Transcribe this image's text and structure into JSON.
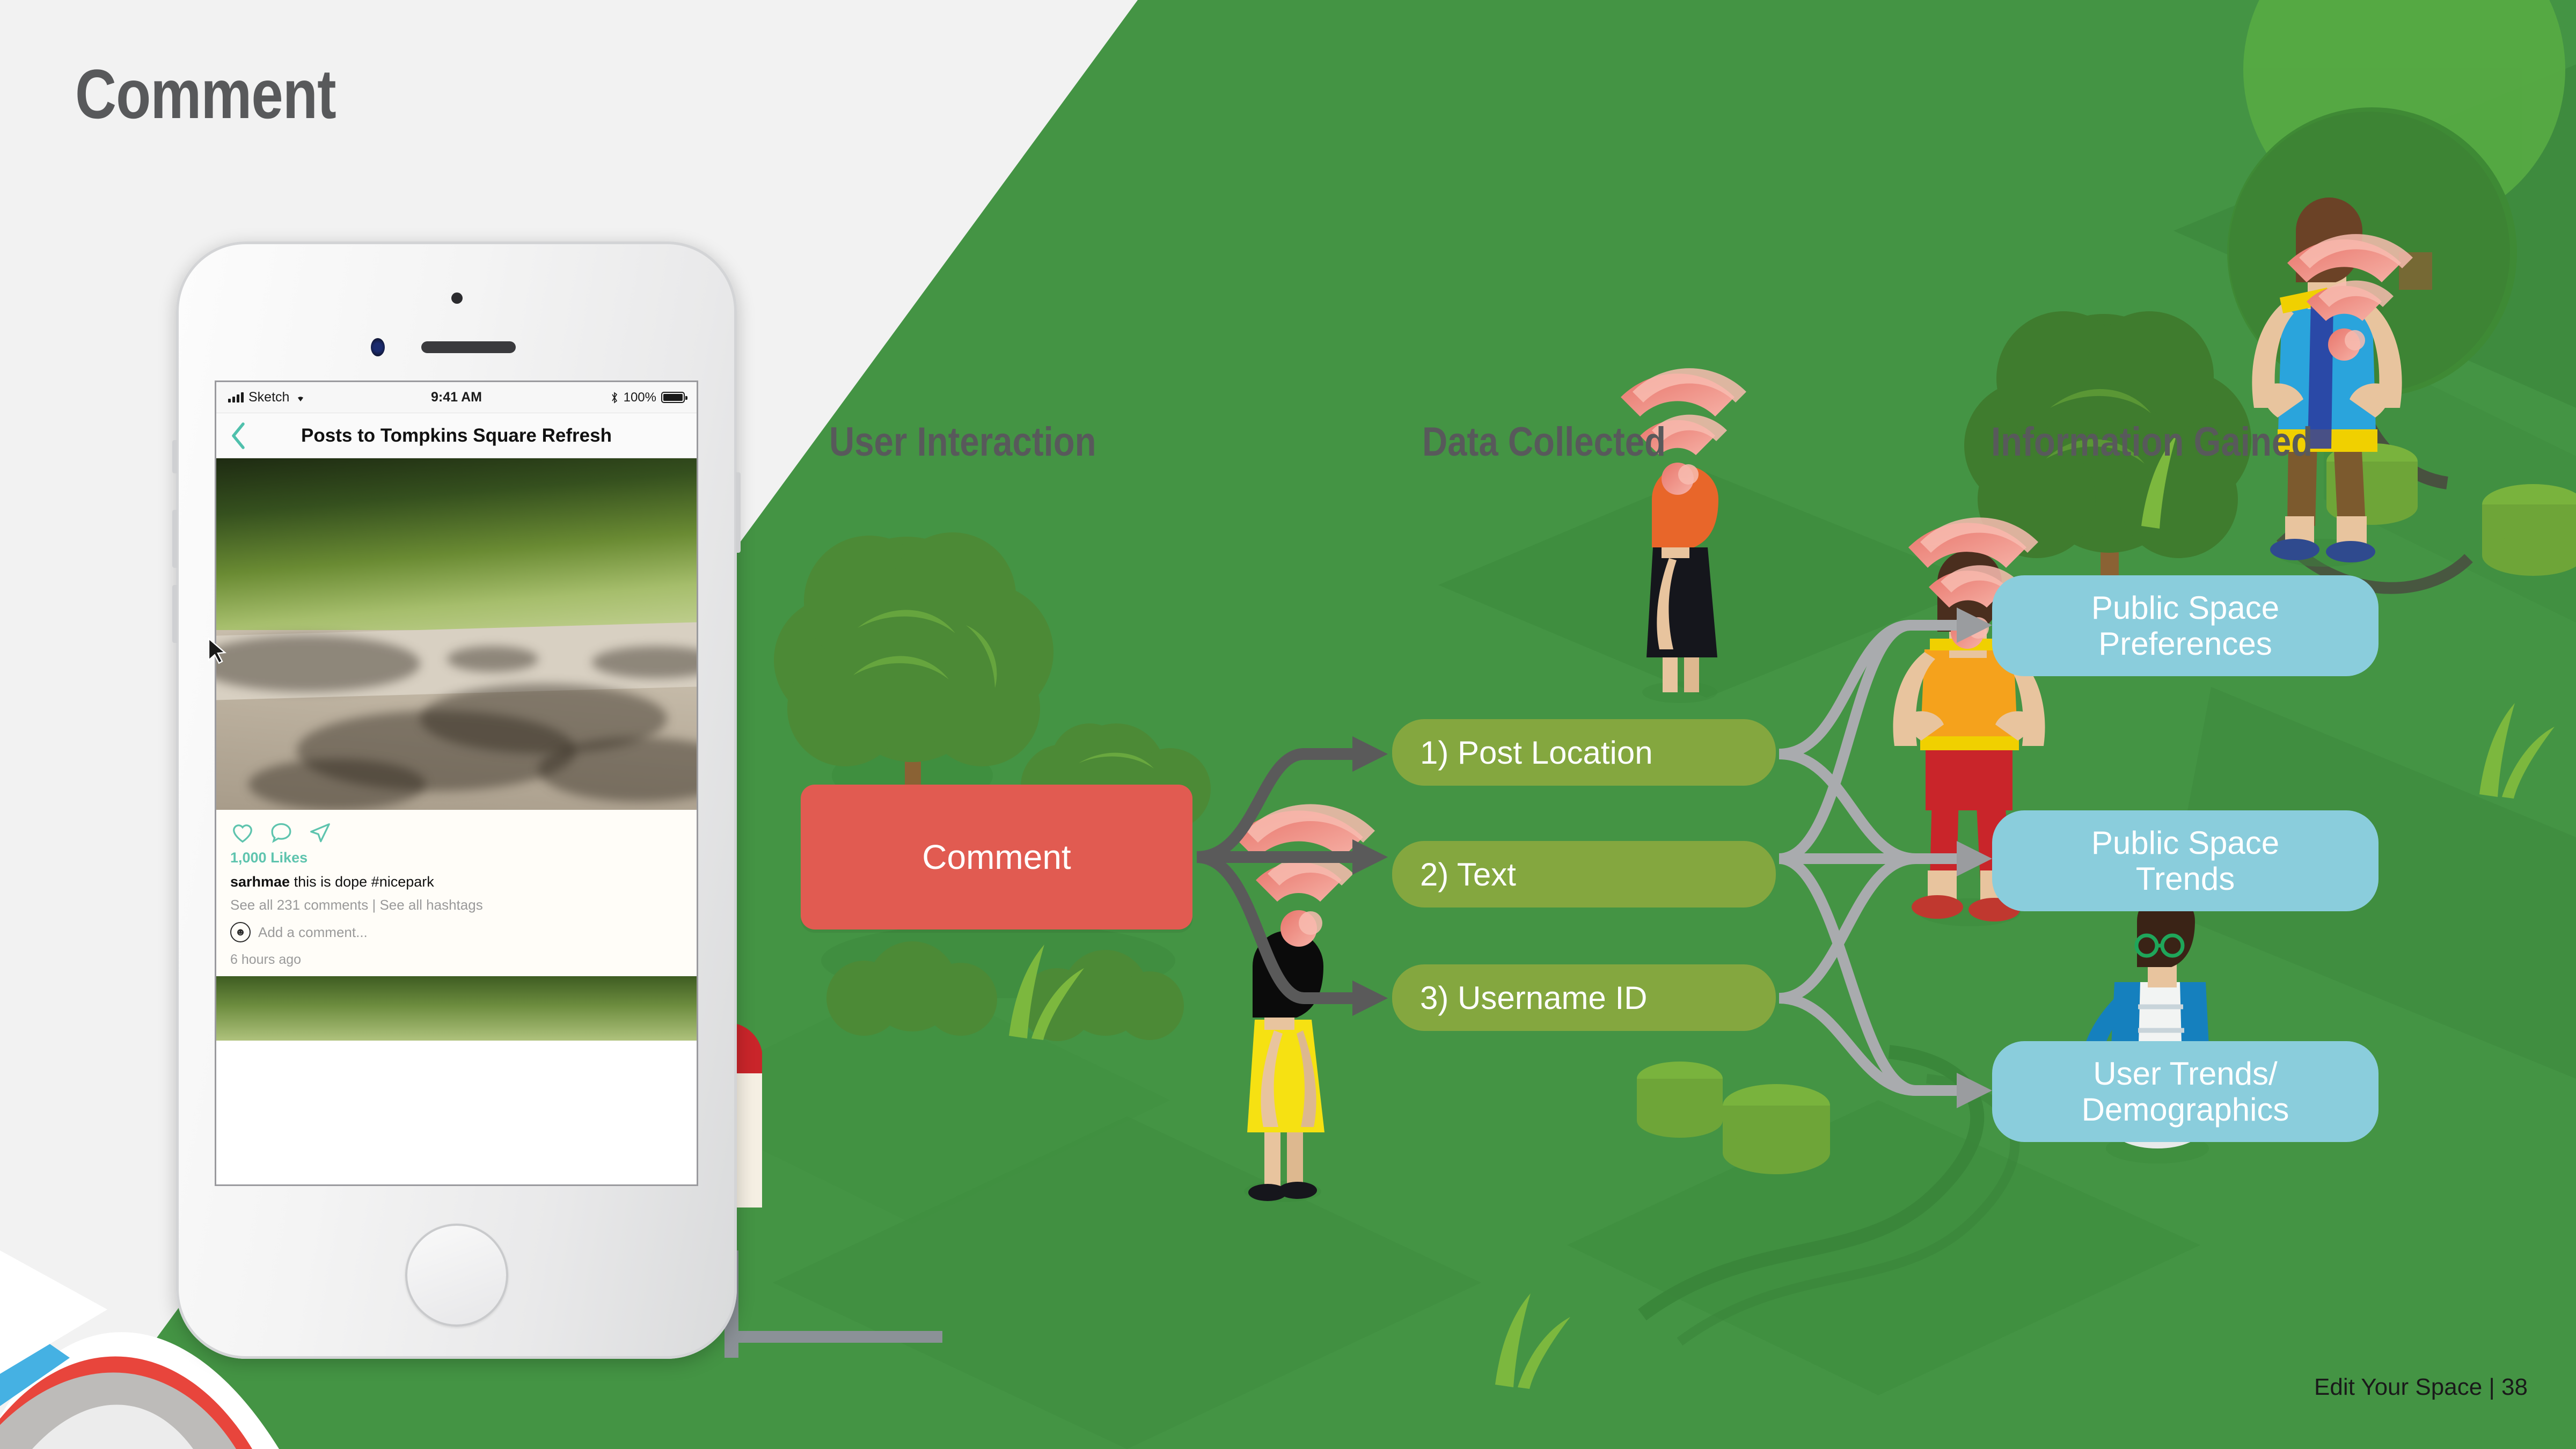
{
  "slide": {
    "title": "Comment",
    "footer": "Edit Your Space | 38",
    "background_color": "#F2F2F2",
    "park_green": "#449444"
  },
  "columns": {
    "user_interaction": "User Interaction",
    "data_collected": "Data Collected",
    "information_gained": "Information Gained"
  },
  "flow": {
    "interaction": {
      "label": "Comment",
      "color": "#E15B51"
    },
    "data_collected": [
      {
        "label": "1) Post Location",
        "color": "#84A73F"
      },
      {
        "label": "2) Text",
        "color": "#84A73F"
      },
      {
        "label": "3) Username ID",
        "color": "#84A73F"
      }
    ],
    "information_gained": [
      {
        "line1": "Public Space",
        "line2": "Preferences",
        "color": "#8ACDDC"
      },
      {
        "line1": "Public Space",
        "line2": "Trends",
        "color": "#8ACDDC"
      },
      {
        "line1": "User Trends/",
        "line2": "Demographics",
        "color": "#8ACDDC"
      }
    ]
  },
  "phone": {
    "status_bar": {
      "carrier": "Sketch",
      "time": "9:41 AM",
      "battery_percent": "100%",
      "bluetooth_icon": "bluetooth-icon",
      "wifi_icon": "wifi-icon",
      "signal_icon": "signal-bars-icon"
    },
    "nav": {
      "back_icon": "chevron-left-icon",
      "title": "Posts to Tompkins Square Refresh"
    },
    "post": {
      "like_icon": "heart-icon",
      "comment_icon": "speech-bubble-icon",
      "share_icon": "paper-plane-icon",
      "likes": "1,000 Likes",
      "caption_user": "sarhmae",
      "caption_text": "this is dope #nicepark",
      "sublinks": "See all 231 comments | See all hashtags",
      "add_comment_placeholder": "Add a comment...",
      "avatar_icon": "user-avatar-icon",
      "timestamp": "6 hours ago"
    }
  }
}
